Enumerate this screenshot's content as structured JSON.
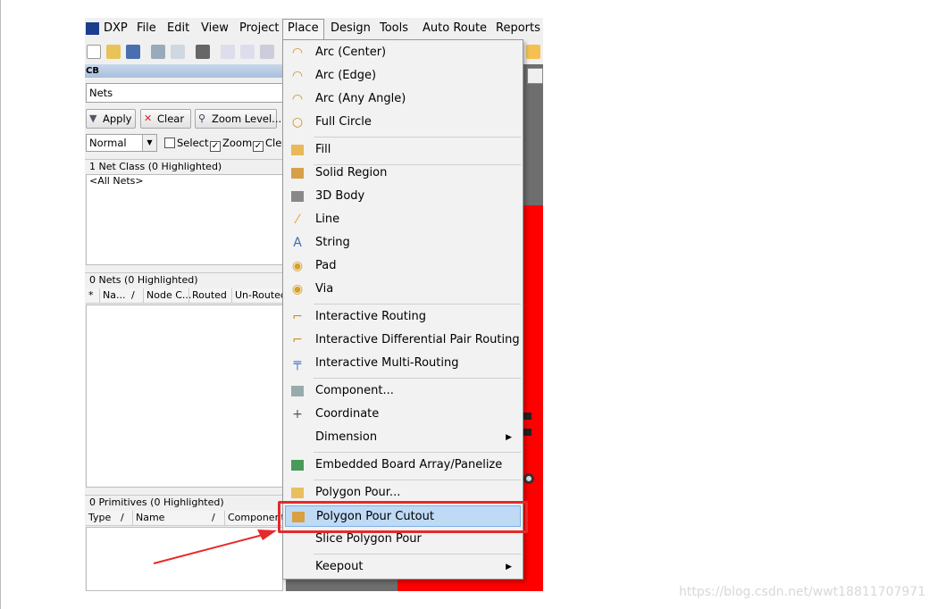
{
  "menubar": {
    "items": [
      {
        "label": "DXP"
      },
      {
        "label": "File"
      },
      {
        "label": "Edit"
      },
      {
        "label": "View"
      },
      {
        "label": "Project"
      },
      {
        "label": "Place"
      },
      {
        "label": "Design"
      },
      {
        "label": "Tools"
      },
      {
        "label": "Auto Route"
      },
      {
        "label": "Reports"
      }
    ]
  },
  "panel": {
    "title": "CB",
    "nets_field": "Nets",
    "buttons": {
      "apply": "Apply",
      "clear": "Clear",
      "zoom_level": "Zoom Level..."
    },
    "mode_select": "Normal",
    "checks": {
      "select": "Select",
      "zoom": "Zoom",
      "clear": "Cle"
    },
    "net_class_header": "1 Net Class (0 Highlighted)",
    "net_class_item": "<All Nets>",
    "nets_header": "0 Nets (0 Highlighted)",
    "nets_columns": [
      "*",
      "Na...",
      "/",
      "Node C...",
      "Routed",
      "Un-Routed"
    ],
    "primitives_header": "0 Primitives (0 Highlighted)",
    "primitives_columns": [
      "Type",
      "/",
      "Name",
      "/",
      "Component"
    ]
  },
  "place_menu": {
    "items": [
      {
        "label": "Arc (Center)",
        "icon": "arc-center-icon"
      },
      {
        "label": "Arc (Edge)",
        "icon": "arc-edge-icon"
      },
      {
        "label": "Arc (Any Angle)",
        "icon": "arc-any-angle-icon"
      },
      {
        "label": "Full Circle",
        "icon": "full-circle-icon"
      },
      {
        "label": "Fill",
        "icon": "fill-icon"
      },
      {
        "label": "Solid Region",
        "icon": "solid-region-icon"
      },
      {
        "label": "3D Body",
        "icon": "3d-body-icon"
      },
      {
        "label": "Line",
        "icon": "line-icon"
      },
      {
        "label": "String",
        "icon": "string-icon"
      },
      {
        "label": "Pad",
        "icon": "pad-icon"
      },
      {
        "label": "Via",
        "icon": "via-icon"
      },
      {
        "label": "Interactive Routing",
        "icon": "interactive-routing-icon"
      },
      {
        "label": "Interactive Differential Pair Routing",
        "icon": "diff-pair-routing-icon"
      },
      {
        "label": "Interactive Multi-Routing",
        "icon": "multi-routing-icon"
      },
      {
        "label": "Component...",
        "icon": "component-icon"
      },
      {
        "label": "Coordinate",
        "icon": "coordinate-icon"
      },
      {
        "label": "Dimension",
        "icon": ""
      },
      {
        "label": "Embedded Board Array/Panelize",
        "icon": "board-array-icon"
      },
      {
        "label": "Polygon Pour...",
        "icon": "polygon-pour-icon"
      },
      {
        "label": "Polygon Pour Cutout",
        "icon": "polygon-cutout-icon"
      },
      {
        "label": "Slice Polygon Pour",
        "icon": ""
      },
      {
        "label": "Keepout",
        "icon": ""
      }
    ]
  },
  "colors": {
    "highlight": "#bfdaf5",
    "annotation": "#e52a2a",
    "pcb_red": "#ff0000"
  },
  "watermark": "https://blog.csdn.net/wwt18811707971"
}
